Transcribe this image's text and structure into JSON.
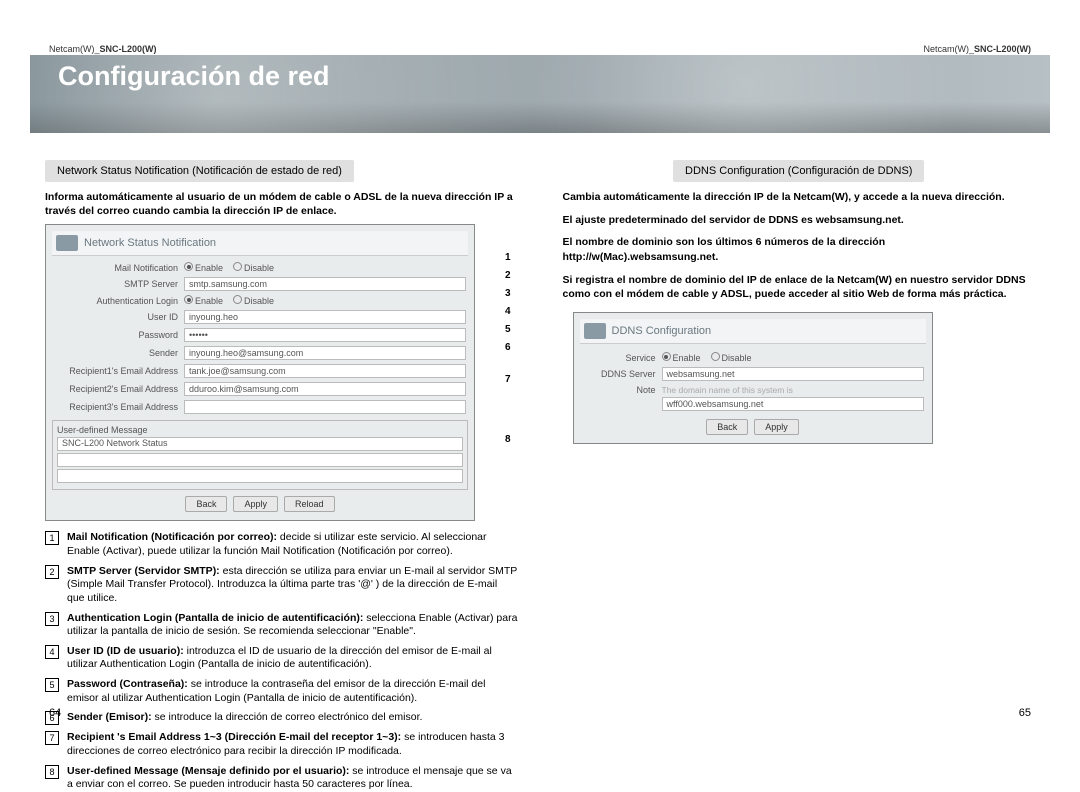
{
  "breadcrumb_left": {
    "prefix": "Netcam(W)_",
    "product": "SNC-L200(W)"
  },
  "breadcrumb_right": {
    "prefix": "Netcam(W)_",
    "product": "SNC-L200(W)"
  },
  "banner_title": "Configuración de red",
  "page_left_num": "64",
  "page_right_num": "65",
  "left": {
    "section_heading": "Network Status Notification (Notificación de estado de red)",
    "intro": "Informa automáticamente al usuario de un módem de cable o ADSL de la nueva dirección IP a través del correo cuando cambia la dirección IP de enlace.",
    "screenshot": {
      "panel_title": "Network Status Notification",
      "rows": {
        "mail_notification_lbl": "Mail Notification",
        "mail_notification_enable": "Enable",
        "mail_notification_disable": "Disable",
        "smtp_lbl": "SMTP Server",
        "smtp_val": "smtp.samsung.com",
        "auth_lbl": "Authentication Login",
        "auth_enable": "Enable",
        "auth_disable": "Disable",
        "userid_lbl": "User ID",
        "userid_val": "inyoung.heo",
        "pw_lbl": "Password",
        "pw_val": "••••••",
        "sender_lbl": "Sender",
        "sender_val": "inyoung.heo@samsung.com",
        "r1_lbl": "Recipient1's Email Address",
        "r1_val": "tank.joe@samsung.com",
        "r2_lbl": "Recipient2's Email Address",
        "r2_val": "dduroo.kim@samsung.com",
        "r3_lbl": "Recipient3's Email Address",
        "r3_val": "",
        "udm_title": "User-defined Message",
        "udm_line1": "SNC-L200 Network Status"
      },
      "buttons": {
        "back": "Back",
        "apply": "Apply",
        "reload": "Reload"
      },
      "markers": {
        "m1": "1",
        "m2": "2",
        "m3": "3",
        "m4": "4",
        "m5": "5",
        "m6": "6",
        "m7": "7",
        "m8": "8"
      }
    },
    "list": [
      {
        "n": "1",
        "bold": "Mail Notification (Notificación por correo):",
        "rest": " decide si utilizar este servicio. Al seleccionar Enable (Activar), puede utilizar la función Mail Notification (Notificación por correo)."
      },
      {
        "n": "2",
        "bold": "SMTP Server (Servidor SMTP):",
        "rest": " esta dirección se utiliza para enviar un E-mail al servidor SMTP (Simple Mail Transfer Protocol). Introduzca la última parte tras '@' ) de la dirección de E-mail que utilice."
      },
      {
        "n": "3",
        "bold": "Authentication Login (Pantalla de inicio de autentificación):",
        "rest": " selecciona Enable (Activar) para utilizar la pantalla de inicio de sesión. Se recomienda seleccionar \"Enable\"."
      },
      {
        "n": "4",
        "bold": "User ID (ID de usuario):",
        "rest": " introduzca el ID de usuario de la dirección del emisor de E-mail al utilizar Authentication Login (Pantalla de inicio de autentificación)."
      },
      {
        "n": "5",
        "bold": "Password (Contraseña):",
        "rest": " se introduce la contraseña del emisor de la dirección E-mail del emisor al utilizar Authentication Login (Pantalla de inicio de autentificación)."
      },
      {
        "n": "6",
        "bold": "Sender (Emisor):",
        "rest": " se introduce la dirección de correo electrónico del emisor."
      },
      {
        "n": "7",
        "bold": "Recipient 's Email Address 1~3 (Dirección E-mail del receptor 1~3):",
        "rest": " se introducen hasta 3 direcciones de correo electrónico para recibir la dirección IP modificada."
      },
      {
        "n": "8",
        "bold": "User-defined Message (Mensaje definido por el usuario):",
        "rest": " se introduce el mensaje que se va a enviar con el correo. Se pueden introducir hasta 50 caracteres por línea."
      }
    ]
  },
  "right": {
    "section_heading": "DDNS Configuration (Configuración de DDNS)",
    "p1": "Cambia automáticamente la dirección IP de la Netcam(W), y accede a la nueva dirección.",
    "p2": "El ajuste predeterminado del servidor de DDNS es websamsung.net.",
    "p3": "El nombre de dominio son los últimos 6 números de la dirección http://w(Mac).websamsung.net.",
    "p4": "Si registra el nombre de dominio del IP de enlace de la Netcam(W) en nuestro servidor DDNS como con el módem de cable y ADSL, puede acceder al sitio Web de forma más práctica.",
    "screenshot": {
      "panel_title": "DDNS Configuration",
      "service_lbl": "Service",
      "service_enable": "Enable",
      "service_disable": "Disable",
      "server_lbl": "DDNS Server",
      "server_val": "websamsung.net",
      "note_lbl": "Note",
      "note_hint": "The domain name of this system is",
      "note_val": "wff000.websamsung.net",
      "buttons": {
        "back": "Back",
        "apply": "Apply"
      }
    }
  }
}
